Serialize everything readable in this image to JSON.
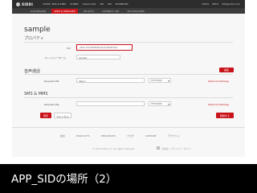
{
  "nav": {
    "logo": "XIDDI",
    "left_items": [
      "VOICE, SMS & MMS",
      "CLIENT",
      "CALLS LOG",
      "API",
      "SIP",
      "EXAMPLES"
    ],
    "right_items": [
      "DOCS",
      "HELP",
      "info@xiddi.com"
    ],
    "sub_items": [
      "DASHBOARD",
      "APPS & SERVICES",
      "API KEYS",
      "CONNECT APP",
      "API EXPLORER"
    ]
  },
  "app": {
    "name": "sample",
    "properties_heading": "プロパティ",
    "sid_label": "Sid",
    "sid_value": "APe1c7b14d0969f4aa37d2d6b9fc8e9",
    "friendly_name_label": "フレンドリーネーム",
    "friendly_name_value": "sample"
  },
  "voice": {
    "heading": "音声通話",
    "edit_label": "編集",
    "request_url_label": "Request URL",
    "request_url_value": "http://",
    "method_value": "HTTP POST",
    "optional_settings": "Optional Settings"
  },
  "sms": {
    "heading": "SMS & MMS",
    "request_url_label": "Request URL",
    "request_url_value": "",
    "method_value": "HTTP POST",
    "optional_settings": "Optional Settings"
  },
  "actions": {
    "save_label": "保存",
    "cancel_label": "キャンセル",
    "delete_label": "削除する"
  },
  "footer": {
    "links": [
      "会社",
      "PRODUCTS",
      "RESOURCES",
      "ブログ",
      "SUPPORT",
      "アカウント"
    ],
    "copyright": "© 2015 Xiddi, Inc. All rights reserved.",
    "lang": "日本語 / プライバシーポリシー"
  },
  "caption": "APP_SIDの場所（2）",
  "colors": {
    "accent": "#c8131b",
    "nav_bg": "#2d2d2d",
    "caption_bg": "#000000"
  }
}
